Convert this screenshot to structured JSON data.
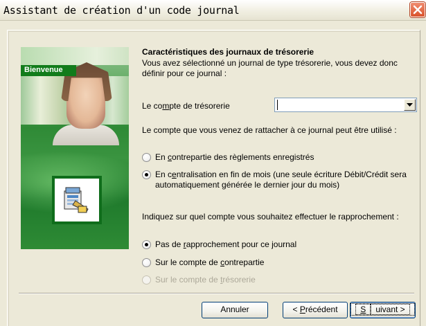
{
  "window": {
    "title": "Assistant de création d'un code journal",
    "close_icon": "close-icon"
  },
  "side_panel": {
    "label": "Bienvenue",
    "icon": "journal-code-icon"
  },
  "content": {
    "heading": "Caractéristiques des journaux de trésorerie",
    "intro": "Vous avez sélectionné un journal de type trésorerie, vous devez donc définir pour ce journal :",
    "account_field": {
      "label_before": "Le co",
      "label_mnemonic": "m",
      "label_after": "pte de trésorerie",
      "value": ""
    },
    "usage_text": "Le compte que vous venez de rattacher à ce journal peut être utilisé :",
    "usage_options": [
      {
        "before": "En ",
        "mnemonic": "c",
        "after": "ontrepartie des règlements enregistrés",
        "checked": false
      },
      {
        "before": "En c",
        "mnemonic": "e",
        "after": "ntralisation en fin de mois (une seule écriture Débit/Crédit sera automatiquement générée le dernier jour du mois)",
        "checked": true
      }
    ],
    "reconciliation_text": "Indiquez sur quel compte vous souhaitez effectuer le rapprochement :",
    "reconciliation_options": [
      {
        "before": "Pas de ",
        "mnemonic": "r",
        "after": "approchement pour ce journal",
        "checked": true,
        "disabled": false
      },
      {
        "before": "Sur le compte de ",
        "mnemonic": "c",
        "after": "ontrepartie",
        "checked": false,
        "disabled": false
      },
      {
        "before": "Sur le compte de ",
        "mnemonic": "t",
        "after": "résorerie",
        "checked": false,
        "disabled": true
      }
    ]
  },
  "buttons": {
    "cancel": "Annuler",
    "prev_before": "< ",
    "prev_mnemonic": "P",
    "prev_after": "récédent",
    "next_mnemonic": "S",
    "next_after": "uivant >"
  }
}
